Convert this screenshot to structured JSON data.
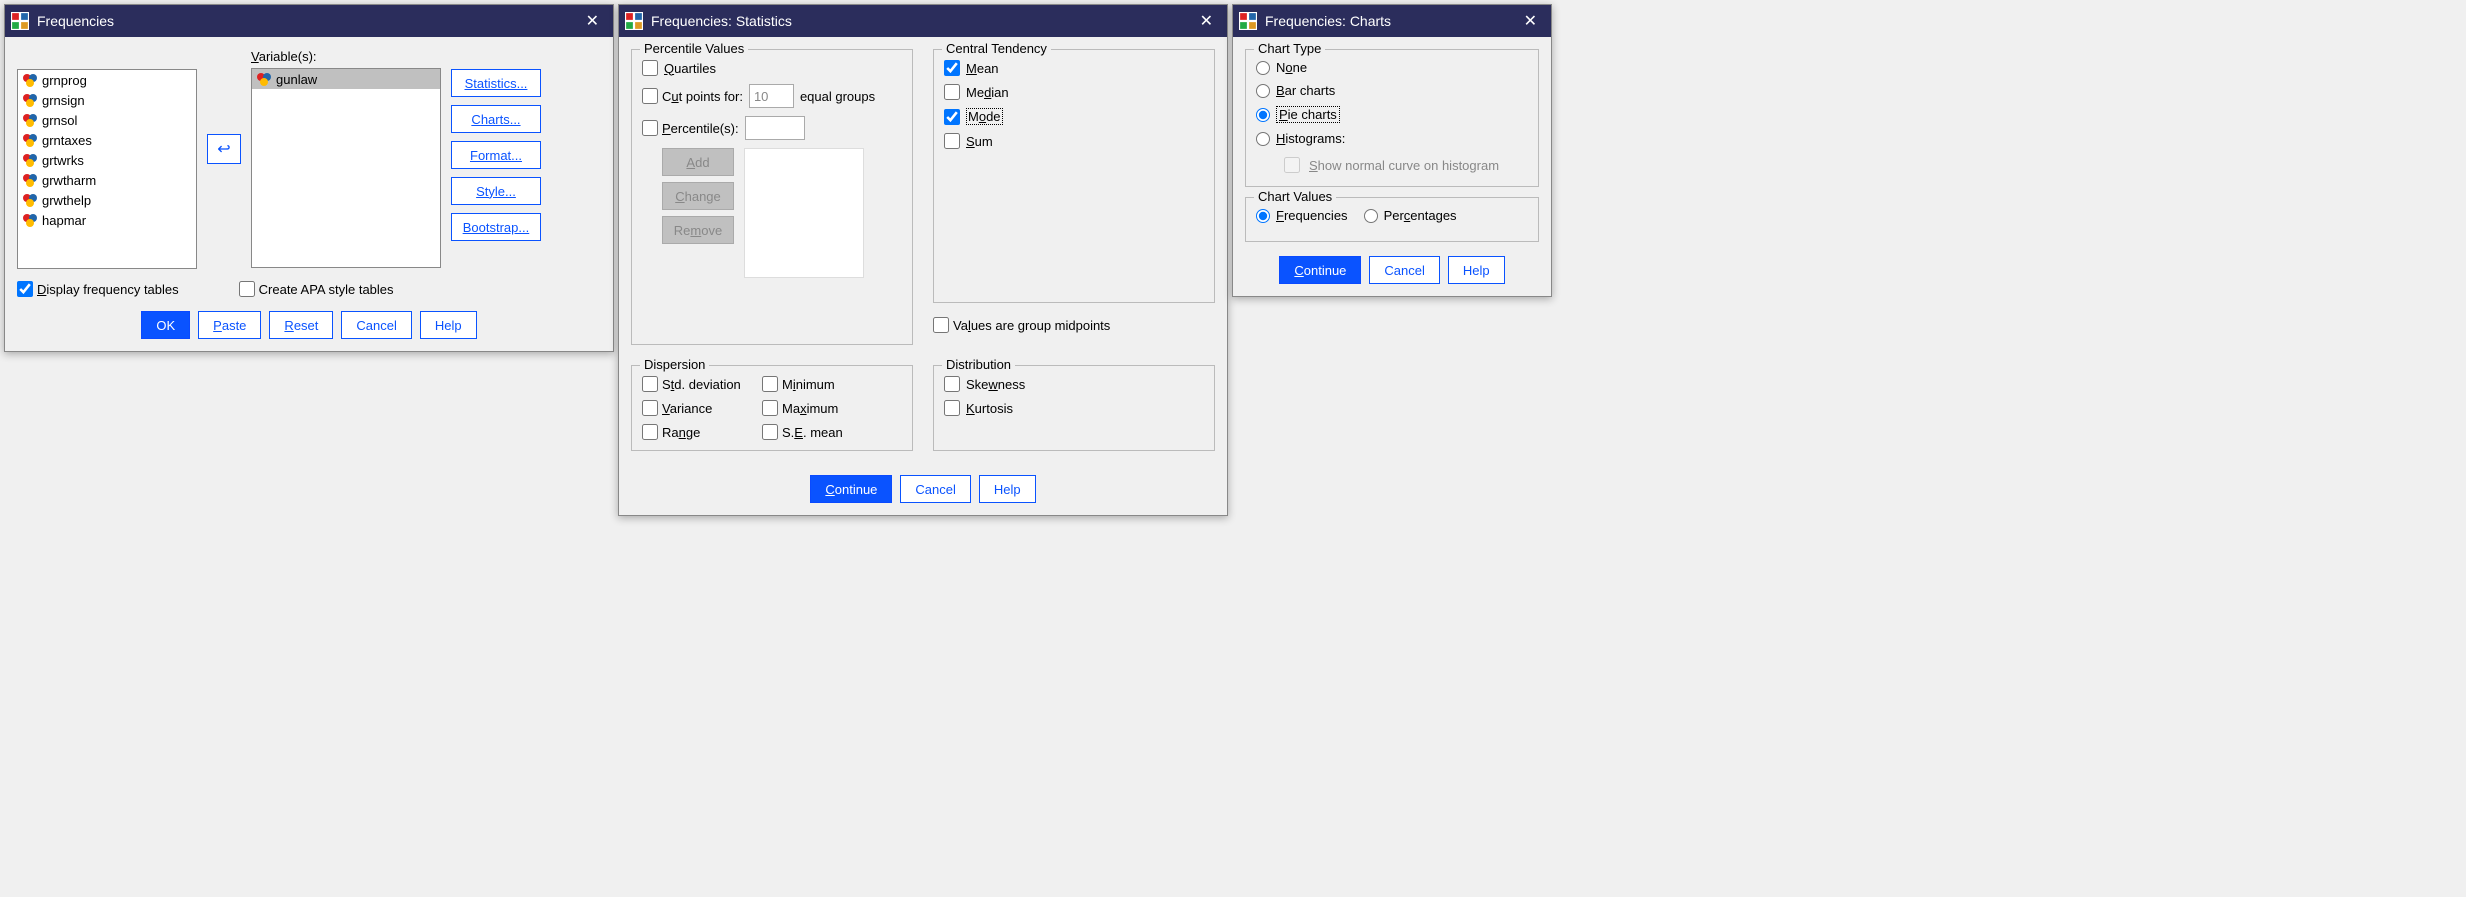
{
  "freq": {
    "title": "Frequencies",
    "vars_label": "Variable(s):",
    "source_items": [
      "grnprog",
      "grnsign",
      "grnsol",
      "grntaxes",
      "grtwrks",
      "grwtharm",
      "grwthelp",
      "hapmar"
    ],
    "selected_items": [
      "gunlaw"
    ],
    "side_buttons": {
      "statistics": "Statistics...",
      "charts": "Charts...",
      "format": "Format...",
      "style": "Style...",
      "bootstrap": "Bootstrap..."
    },
    "display_tables": "Display frequency tables",
    "create_apa": "Create APA style tables",
    "footer": {
      "ok": "OK",
      "paste": "Paste",
      "reset": "Reset",
      "cancel": "Cancel",
      "help": "Help"
    }
  },
  "stats": {
    "title": "Frequencies: Statistics",
    "percentile_values": {
      "legend": "Percentile Values",
      "quartiles": "Quartiles",
      "cut_prefix": "Cut points for:",
      "cut_value": "10",
      "cut_suffix": "equal groups",
      "percentiles": "Percentile(s):",
      "add": "Add",
      "change": "Change",
      "remove": "Remove"
    },
    "central_tendency": {
      "legend": "Central Tendency",
      "mean": "Mean",
      "median": "Median",
      "mode": "Mode",
      "sum": "Sum"
    },
    "values_group": "Values are group midpoints",
    "dispersion": {
      "legend": "Dispersion",
      "std": "Std. deviation",
      "variance": "Variance",
      "range": "Range",
      "min": "Minimum",
      "max": "Maximum",
      "se": "S.E. mean"
    },
    "distribution": {
      "legend": "Distribution",
      "skew": "Skewness",
      "kurt": "Kurtosis"
    },
    "footer": {
      "continue": "Continue",
      "cancel": "Cancel",
      "help": "Help"
    }
  },
  "charts": {
    "title": "Frequencies: Charts",
    "chart_type": {
      "legend": "Chart Type",
      "none": "None",
      "bar": "Bar charts",
      "pie": "Pie charts",
      "hist": "Histograms:",
      "show_normal": "Show normal curve on histogram"
    },
    "chart_values": {
      "legend": "Chart Values",
      "freq": "Frequencies",
      "perc": "Percentages"
    },
    "footer": {
      "continue": "Continue",
      "cancel": "Cancel",
      "help": "Help"
    }
  }
}
